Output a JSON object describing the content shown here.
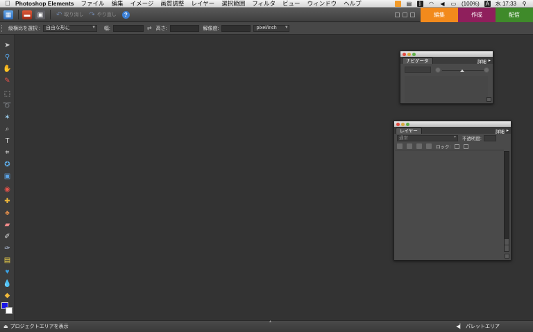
{
  "menubar": {
    "apple": "",
    "app_name": "Photoshop Elements",
    "items": [
      "ファイル",
      "編集",
      "イメージ",
      "画質調整",
      "レイヤー",
      "選択範囲",
      "フィルタ",
      "ビュー",
      "ウィンドウ",
      "ヘルプ"
    ],
    "battery": "(100%)",
    "input_mode": "A",
    "clock": "水 17:33"
  },
  "toolbar": {
    "undo_label": "取り消し",
    "redo_label": "やり直し",
    "help_label": "?",
    "modes": [
      {
        "label": "編集",
        "color": "#f28a1c"
      },
      {
        "label": "作成",
        "color": "#8f1f5c"
      },
      {
        "label": "配信",
        "color": "#3f8a2a"
      }
    ]
  },
  "options": {
    "ratio_label": "縦横比を選択 :",
    "ratio_value": "自由な形に",
    "width_label": "幅:",
    "height_label": "高さ:",
    "resolution_label": "解像度:",
    "unit_value": "pixel/inch"
  },
  "navigator": {
    "tab": "ナビゲータ",
    "more": "詳細"
  },
  "layers": {
    "tab": "レイヤー",
    "more": "詳細",
    "blend_mode": "通常",
    "opacity_label": "不透明度:",
    "lock_label": "ロック:"
  },
  "status": {
    "project_bin": "プロジェクトエリアを表示",
    "palette_bin": "パレットエリア"
  },
  "colors": {
    "foreground": "#1a16e6",
    "background": "#ffffff"
  }
}
